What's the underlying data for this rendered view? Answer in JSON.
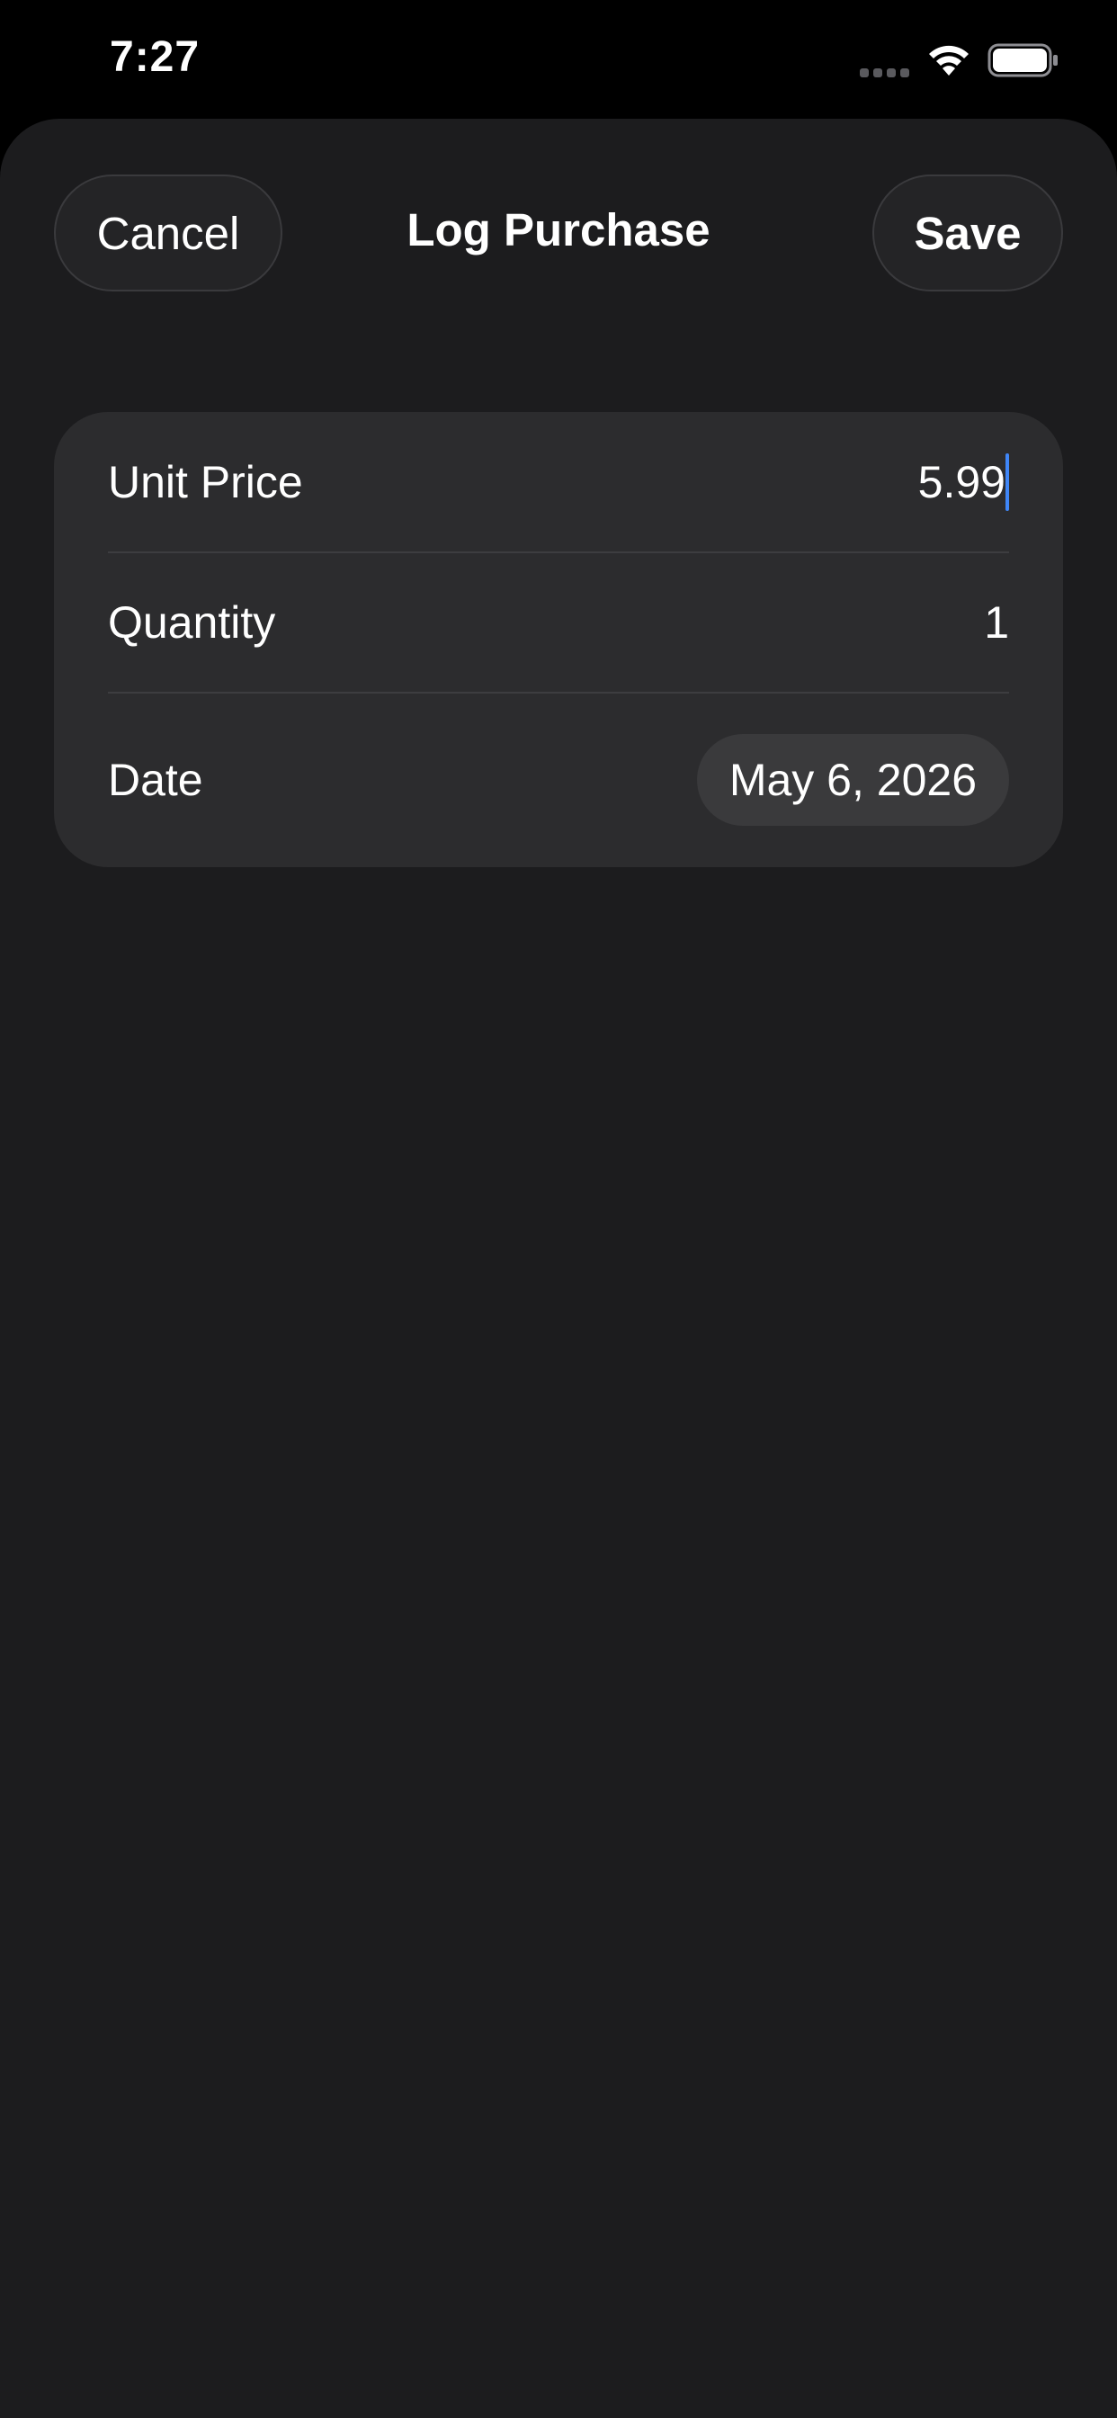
{
  "status_bar": {
    "time": "7:27",
    "icons": [
      "cellular-signal-icon",
      "wifi-icon",
      "battery-icon"
    ]
  },
  "sheet": {
    "title": "Log Purchase",
    "cancel_label": "Cancel",
    "save_label": "Save"
  },
  "form": {
    "rows": [
      {
        "label": "Unit Price",
        "value": "5.99"
      },
      {
        "label": "Quantity",
        "value": "1"
      },
      {
        "label": "Date",
        "value": "May 6, 2026"
      }
    ]
  },
  "colors": {
    "background": "#1c1c1e",
    "card": "#2c2c2e",
    "accent_cursor": "#3f86f7",
    "text": "#ffffff"
  }
}
